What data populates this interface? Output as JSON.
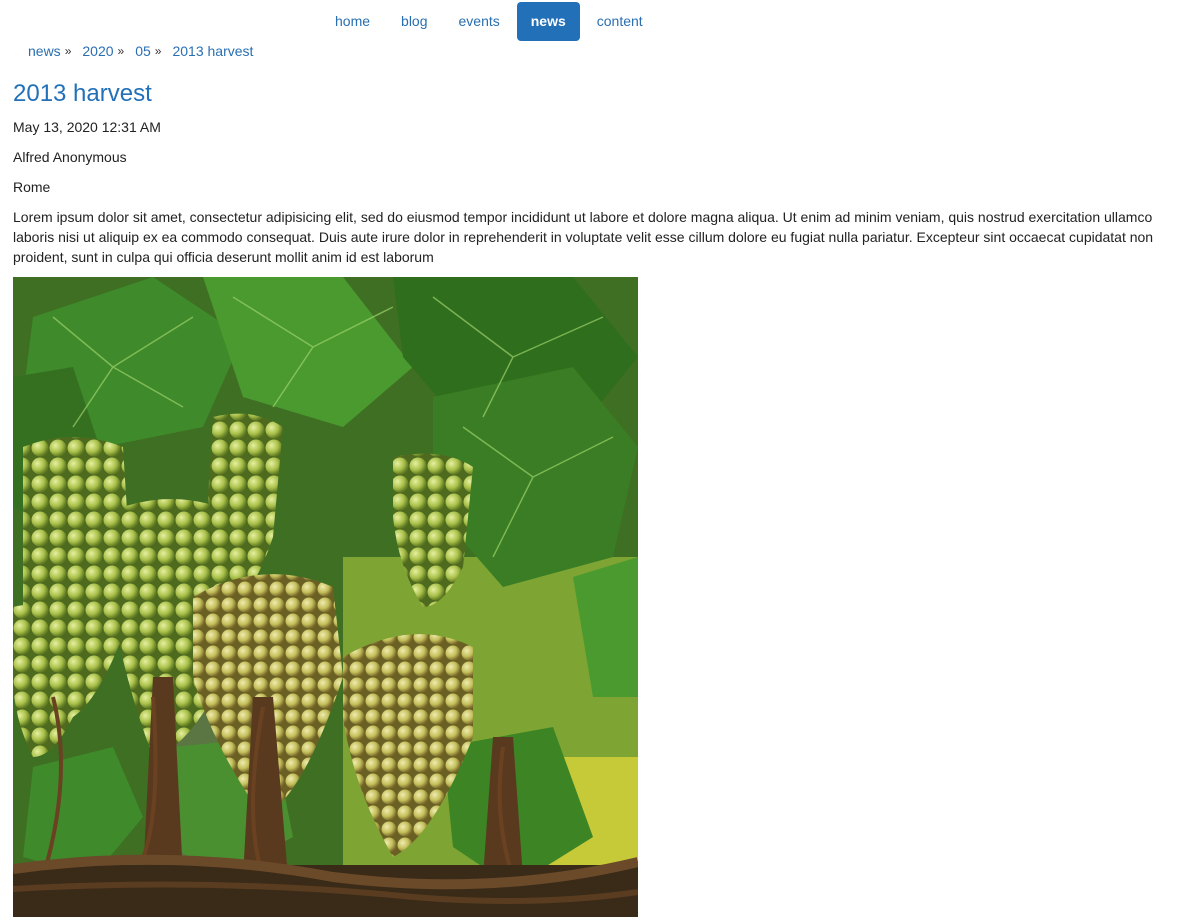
{
  "nav": {
    "items": [
      {
        "label": "home",
        "active": false
      },
      {
        "label": "blog",
        "active": false
      },
      {
        "label": "events",
        "active": false
      },
      {
        "label": "news",
        "active": true
      },
      {
        "label": "content",
        "active": false
      }
    ],
    "active_color": "#2270b8",
    "link_color": "#2a6fb0"
  },
  "breadcrumb": {
    "items": [
      "news",
      "2020",
      "05",
      "2013 harvest"
    ],
    "separator": "»"
  },
  "article": {
    "title": "2013 harvest",
    "date": "May 13, 2020 12:31 AM",
    "author": "Alfred Anonymous",
    "location": "Rome",
    "body": "Lorem ipsum dolor sit amet, consectetur adipisicing elit, sed do eiusmod tempor incididunt ut labore et dolore magna aliqua. Ut enim ad minim veniam, quis nostrud exercitation ullamco laboris nisi ut aliquip ex ea commodo consequat. Duis aute irure dolor in reprehenderit in voluptate velit esse cillum dolore eu fugiat nulla pariatur. Excepteur sint occaecat cupidatat non proident, sunt in culpa qui officia deserunt mollit anim id est laborum",
    "image": {
      "subject": "green grapes on vine",
      "caption": ""
    }
  }
}
